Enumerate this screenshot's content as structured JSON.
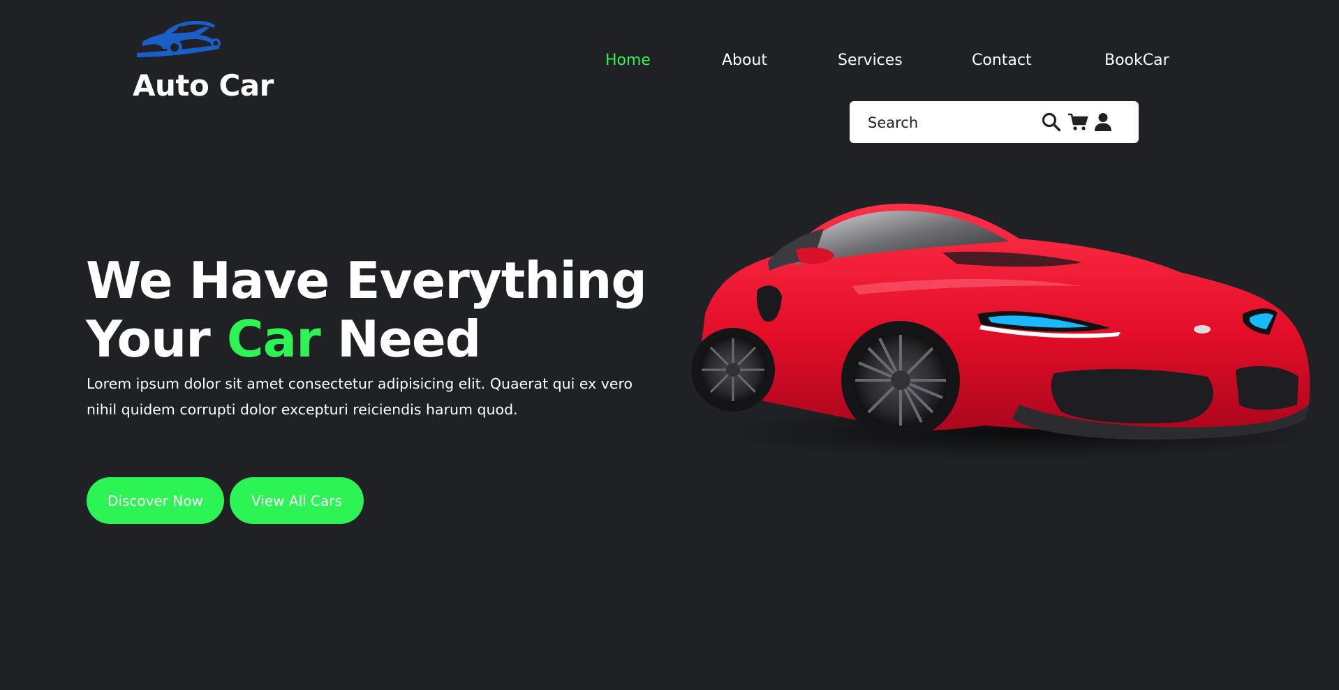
{
  "brand": {
    "name": "Auto Car",
    "logo_icon": "car-silhouette-icon",
    "logo_color": "#1a5fc8"
  },
  "nav": {
    "items": [
      {
        "label": "Home",
        "active": true
      },
      {
        "label": "About",
        "active": false
      },
      {
        "label": "Services",
        "active": false
      },
      {
        "label": "Contact",
        "active": false
      },
      {
        "label": "BookCar",
        "active": false
      }
    ]
  },
  "search": {
    "placeholder": "Search",
    "icons": [
      "search-icon",
      "cart-icon",
      "user-icon"
    ]
  },
  "hero": {
    "title_line1": "We Have Everything",
    "title_line2_pre": "Your ",
    "title_line2_accent": "Car",
    "title_line2_post": " Need",
    "description": "Lorem ipsum dolor sit amet consectetur adipisicing elit. Quaerat qui ex vero nihil quidem corrupti dolor excepturi reiciendis harum quod.",
    "buttons": [
      {
        "label": "Discover Now"
      },
      {
        "label": "View All Cars"
      }
    ],
    "image": "red-sports-car"
  },
  "colors": {
    "background": "#202124",
    "accent": "#2cf454",
    "text": "#ffffff",
    "car_red": "#e8102e"
  }
}
